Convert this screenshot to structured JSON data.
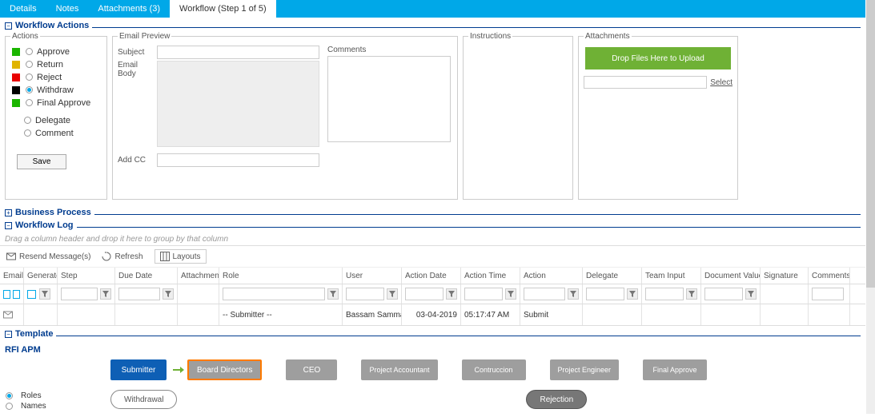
{
  "tabs": {
    "details": "Details",
    "notes": "Notes",
    "attachments": "Attachments (3)",
    "workflow": "Workflow (Step 1 of 5)"
  },
  "sections": {
    "workflow_actions": "Workflow Actions",
    "business_process": "Business Process",
    "workflow_log": "Workflow Log",
    "template": "Template"
  },
  "actions_panel": {
    "legend": "Actions",
    "approve": "Approve",
    "return": "Return",
    "reject": "Reject",
    "withdraw": "Withdraw",
    "final_approve": "Final Approve",
    "delegate": "Delegate",
    "comment": "Comment",
    "save": "Save"
  },
  "email_preview": {
    "legend": "Email Preview",
    "subject_label": "Subject",
    "body_label": "Email Body",
    "addcc_label": "Add CC",
    "comments_label": "Comments"
  },
  "instructions": {
    "legend": "Instructions"
  },
  "attachments": {
    "legend": "Attachments",
    "dropzone": "Drop Files Here to Upload",
    "select": "Select"
  },
  "grid": {
    "group_hint": "Drag a column header and drop it here to group by that column",
    "toolbar": {
      "resend": "Resend Message(s)",
      "refresh": "Refresh",
      "layouts": "Layouts"
    },
    "headers": {
      "email": "Email",
      "generated": "Generated",
      "step": "Step",
      "due_date": "Due Date",
      "attachments": "Attachments",
      "role": "Role",
      "user": "User",
      "action_date": "Action Date",
      "action_time": "Action Time",
      "action": "Action",
      "delegate": "Delegate",
      "team_input": "Team Input",
      "document_value": "Document Value",
      "signature": "Signature",
      "comments": "Comments"
    },
    "row": {
      "role": "-- Submitter --",
      "user": "Bassam Samman(Ba",
      "action_date": "03-04-2019",
      "action_time": "05:17:47 AM",
      "action": "Submit"
    }
  },
  "template": {
    "title": "RFI APM",
    "radio_roles": "Roles",
    "radio_names": "Names",
    "nodes": {
      "submitter": "Submitter",
      "board": "Board Directors",
      "ceo": "CEO",
      "project_accountant": "Project Accountant",
      "contruccion": "Contruccion",
      "project_engineer": "Project Engineer",
      "final_approve": "Final Approve",
      "withdrawal": "Withdrawal",
      "rejection": "Rejection"
    }
  }
}
